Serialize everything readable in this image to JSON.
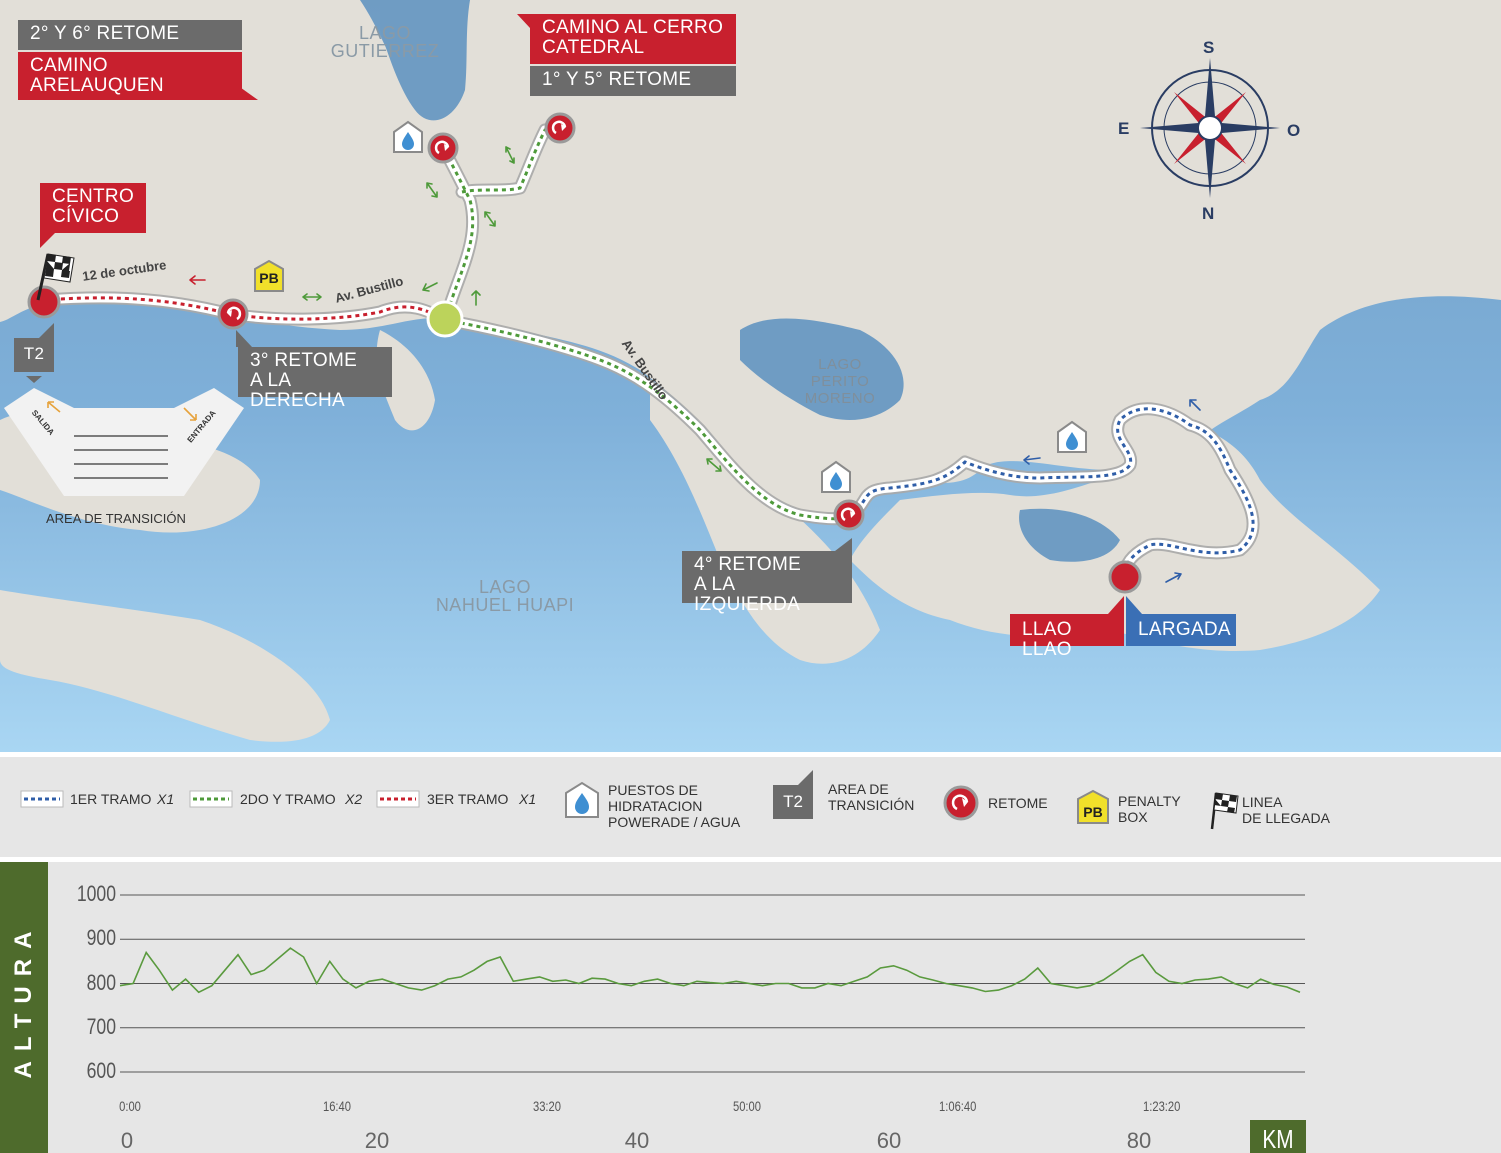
{
  "map": {
    "labels": {
      "retome_2_6": "2° Y 6° RETOME",
      "camino_arelauquen": "CAMINO\nARELAUQUEN",
      "camino_cerro": "CAMINO AL CERRO\nCATEDRAL",
      "retome_1_5": "1° Y 5° RETOME",
      "centro_civico": "CENTRO\nCÍVICO",
      "retome_3": "3° RETOME\nA LA DERECHA",
      "retome_4": "4° RETOME\nA LA IZQUIERDA",
      "llao_llao": "LLAO LLAO",
      "largada": "LARGADA",
      "t2": "T2"
    },
    "lakes": {
      "gutierrez": "LAGO\nGUTIERREZ",
      "perito_moreno": "LAGO\nPERITO\nMORENO",
      "nahuel_huapi": "LAGO\nNAHUEL HUAPI"
    },
    "roads": {
      "street_12_octubre": "12 de octubre",
      "bustillo_1": "Av. Bustillo",
      "bustillo_2": "Av. Bustillo"
    },
    "compass": {
      "s": "S",
      "e": "E",
      "o": "O",
      "n": "N"
    },
    "transition": {
      "salida": "SALIDA",
      "entrada": "ENTRADA",
      "title": "AREA DE TRANSICIÓN"
    },
    "pb": "PB"
  },
  "legend": {
    "tramo1": {
      "label": "1ER TRAMO",
      "mult": "X1"
    },
    "tramo2": {
      "label": "2DO Y TRAMO",
      "mult": "X2"
    },
    "tramo3": {
      "label": "3ER TRAMO",
      "mult": "X1"
    },
    "hydration": "PUESTOS DE\nHIDRATACION\nPOWERADE / AGUA",
    "t2_badge": "T2",
    "transition": "AREA DE\nTRANSICIÓN",
    "retome": "RETOME",
    "pb_badge": "PB",
    "penalty": "PENALTY\nBOX",
    "finish": "LINEA\nDE LLEGADA"
  },
  "colors": {
    "tramo1": "#2f5ea8",
    "tramo2": "#4e9a3a",
    "tramo3": "#c8202e",
    "red": "#c8202e",
    "gray": "#6b6b6b",
    "blue": "#3a6fb5",
    "elevation_line": "#5a9a3e",
    "altura_bar": "#4e6b2c"
  },
  "chart_data": {
    "type": "line",
    "ylabel": "ALTURA",
    "xlabel": "KM",
    "ylim": [
      600,
      1000
    ],
    "yticks": [
      "1000",
      "900",
      "800",
      "700",
      "600"
    ],
    "time_ticks": [
      "0:00",
      "16:40",
      "33:20",
      "50:00",
      "1:06:40",
      "1:23:20"
    ],
    "km_ticks": [
      "0",
      "20",
      "40",
      "60",
      "80"
    ],
    "grid": true,
    "series": [
      {
        "x": [
          0,
          1,
          2,
          3,
          4,
          5,
          6,
          7,
          8,
          9,
          10,
          11,
          12,
          13,
          14,
          15,
          16,
          17,
          18,
          19,
          20,
          21,
          22,
          23,
          24,
          25,
          26,
          27,
          28,
          29,
          30,
          31,
          32,
          33,
          34,
          35,
          36,
          37,
          38,
          39,
          40,
          41,
          42,
          43,
          44,
          45,
          46,
          47,
          48,
          49,
          50,
          51,
          52,
          53,
          54,
          55,
          56,
          57,
          58,
          59,
          60,
          61,
          62,
          63,
          64,
          65,
          66,
          67,
          68,
          69,
          70,
          71,
          72,
          73,
          74,
          75,
          76,
          77,
          78,
          79,
          80,
          81,
          82,
          83,
          84,
          85,
          86,
          87,
          88,
          89,
          90
        ],
        "y": [
          795,
          800,
          870,
          830,
          785,
          810,
          780,
          795,
          830,
          865,
          820,
          830,
          855,
          880,
          860,
          800,
          850,
          810,
          790,
          805,
          810,
          800,
          790,
          785,
          795,
          810,
          815,
          830,
          850,
          860,
          805,
          810,
          815,
          805,
          808,
          800,
          812,
          810,
          800,
          795,
          805,
          810,
          800,
          795,
          805,
          802,
          800,
          805,
          800,
          795,
          800,
          800,
          790,
          790,
          800,
          795,
          805,
          815,
          835,
          840,
          830,
          815,
          808,
          800,
          795,
          790,
          782,
          785,
          795,
          810,
          835,
          800,
          795,
          790,
          795,
          808,
          828,
          850,
          865,
          825,
          805,
          800,
          808,
          810,
          815,
          800,
          790,
          810,
          798,
          792,
          780
        ]
      }
    ]
  }
}
